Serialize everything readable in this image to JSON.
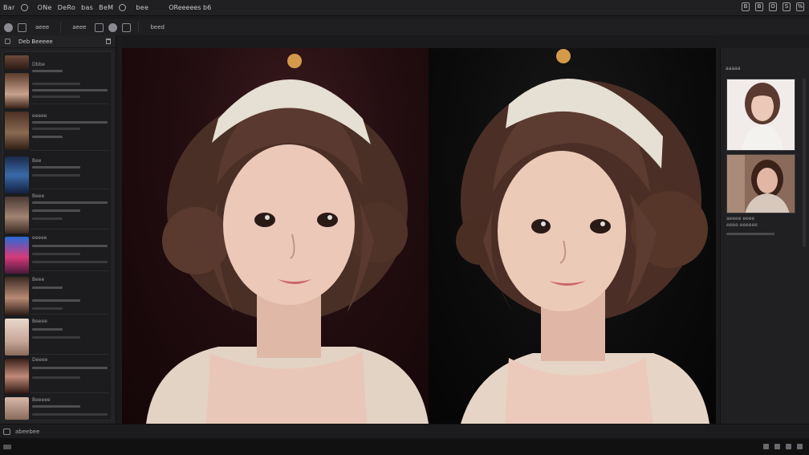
{
  "menubar": {
    "items": [
      "Bar",
      "ONe",
      "DeRo",
      "bas",
      "BeM"
    ],
    "extra_items": [
      "bee",
      "beed"
    ],
    "document_title": "OReeeees b6",
    "window_controls": [
      "B",
      "B",
      "O",
      "S",
      "%"
    ]
  },
  "toolbar": {
    "label_a": "aeee",
    "label_b": "aeee"
  },
  "left_panel": {
    "title": "Deb Beeeee",
    "items": [
      {
        "label": "Dbbe"
      },
      {
        "label": "eeeee"
      },
      {
        "label": "Bee"
      },
      {
        "label": "Beee"
      },
      {
        "label": "eeeee"
      },
      {
        "label": "Beee"
      },
      {
        "label": "Beeee"
      },
      {
        "label": "Deeee"
      },
      {
        "label": "Beeeee"
      }
    ]
  },
  "right_panel": {
    "heading": "aaaaa",
    "caption_a": "aeeee eeee",
    "caption_b": "eeee eeeeee"
  },
  "statusbar": {
    "label": "abeebee"
  },
  "colors": {
    "background": "#1b1b1d",
    "panel": "#222224",
    "canvas": "#0a0a0a",
    "left_image_bg": "#220d10",
    "hair": "#5a3a30",
    "skin": "#e8c4b4",
    "headband": "#e6dfd3"
  },
  "icons": {
    "app_logo": "ring-icon",
    "left_panel_menu": "menu-icon",
    "trash": "trash-icon",
    "status_image": "image-icon"
  }
}
